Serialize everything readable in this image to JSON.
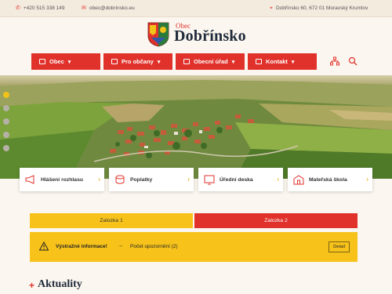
{
  "topbar": {
    "phone": "+420 515 338 149",
    "email": "obec@dobrinsko.eu",
    "address": "Dobřínsko 60, 672 01 Moravský Krumlov"
  },
  "header": {
    "brand_small": "Obec",
    "brand_big": "Dobřínsko"
  },
  "nav": {
    "items": [
      {
        "label": "Obec",
        "icon": "building-icon"
      },
      {
        "label": "Pro občany",
        "icon": "people-icon"
      },
      {
        "label": "Obecní úřad",
        "icon": "office-icon"
      },
      {
        "label": "Kontakt",
        "icon": "contact-card-icon"
      }
    ],
    "utility": [
      "sitemap-icon",
      "search-icon"
    ]
  },
  "hero": {
    "slides": 5,
    "active_slide": 1
  },
  "quicklinks": [
    {
      "label": "Hlášení rozhlasu",
      "icon": "megaphone-icon"
    },
    {
      "label": "Poplatky",
      "icon": "coins-icon"
    },
    {
      "label": "Úřední deska",
      "icon": "board-icon"
    },
    {
      "label": "Mateřská škola",
      "icon": "school-icon"
    }
  ],
  "tabs": [
    "Zalozka 1",
    "Zalozka 2"
  ],
  "warning": {
    "title": "Výstražné informace!",
    "arrow": "→",
    "count_text": "Počet upozornění (2)",
    "detail": "Detail"
  },
  "news": {
    "title": "Aktuality",
    "plus": "+"
  },
  "colors": {
    "accent": "#e0312b",
    "warning": "#f7c31b",
    "background": "#fbf6ef"
  }
}
